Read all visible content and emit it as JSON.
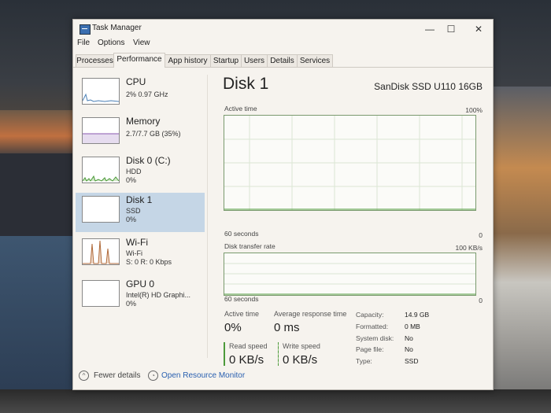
{
  "window": {
    "title": "Task Manager",
    "minimize": "—",
    "maximize": "☐",
    "close": "✕"
  },
  "menu": [
    "File",
    "Options",
    "View"
  ],
  "tabs": [
    "Processes",
    "Performance",
    "App history",
    "Startup",
    "Users",
    "Details",
    "Services"
  ],
  "active_tab": "Performance",
  "sidebar": [
    {
      "name": "CPU",
      "line1": "2% 0.97 GHz",
      "line2": ""
    },
    {
      "name": "Memory",
      "line1": "2.7/7.7 GB (35%)",
      "line2": ""
    },
    {
      "name": "Disk 0 (C:)",
      "line1": "HDD",
      "line2": "0%"
    },
    {
      "name": "Disk 1",
      "line1": "SSD",
      "line2": "0%"
    },
    {
      "name": "Wi-Fi",
      "line1": "Wi-Fi",
      "line2": "S: 0 R: 0 Kbps"
    },
    {
      "name": "GPU 0",
      "line1": "Intel(R) HD Graphi...",
      "line2": "0%"
    }
  ],
  "selected_item": "Disk 1",
  "detail": {
    "title": "Disk 1",
    "model": "SanDisk SSD U110 16GB",
    "graph1": {
      "label": "Active time",
      "max": "100%",
      "time": "60 seconds",
      "min": "0"
    },
    "graph2": {
      "label": "Disk transfer rate",
      "max": "100 KB/s",
      "time": "60 seconds",
      "min": "0"
    },
    "active_time_label": "Active time",
    "active_time_value": "0%",
    "avg_response_label": "Average response time",
    "avg_response_value": "0 ms",
    "read_label": "Read speed",
    "read_value": "0 KB/s",
    "write_label": "Write speed",
    "write_value": "0 KB/s",
    "properties": [
      {
        "label": "Capacity:",
        "value": "14.9 GB"
      },
      {
        "label": "Formatted:",
        "value": "0 MB"
      },
      {
        "label": "System disk:",
        "value": "No"
      },
      {
        "label": "Page file:",
        "value": "No"
      },
      {
        "label": "Type:",
        "value": "SSD"
      }
    ]
  },
  "footer": {
    "fewer_details": "Fewer details",
    "resource_monitor": "Open Resource Monitor"
  },
  "colors": {
    "accent": "#3b6fb0",
    "graph_border": "#7a9a6e",
    "cpu": "#4a7fb5",
    "memory": "#8a5ab0",
    "disk": "#4c9a3a",
    "wifi": "#b06a3a",
    "selected": "#c5d6e6",
    "link": "#2a60b0"
  }
}
